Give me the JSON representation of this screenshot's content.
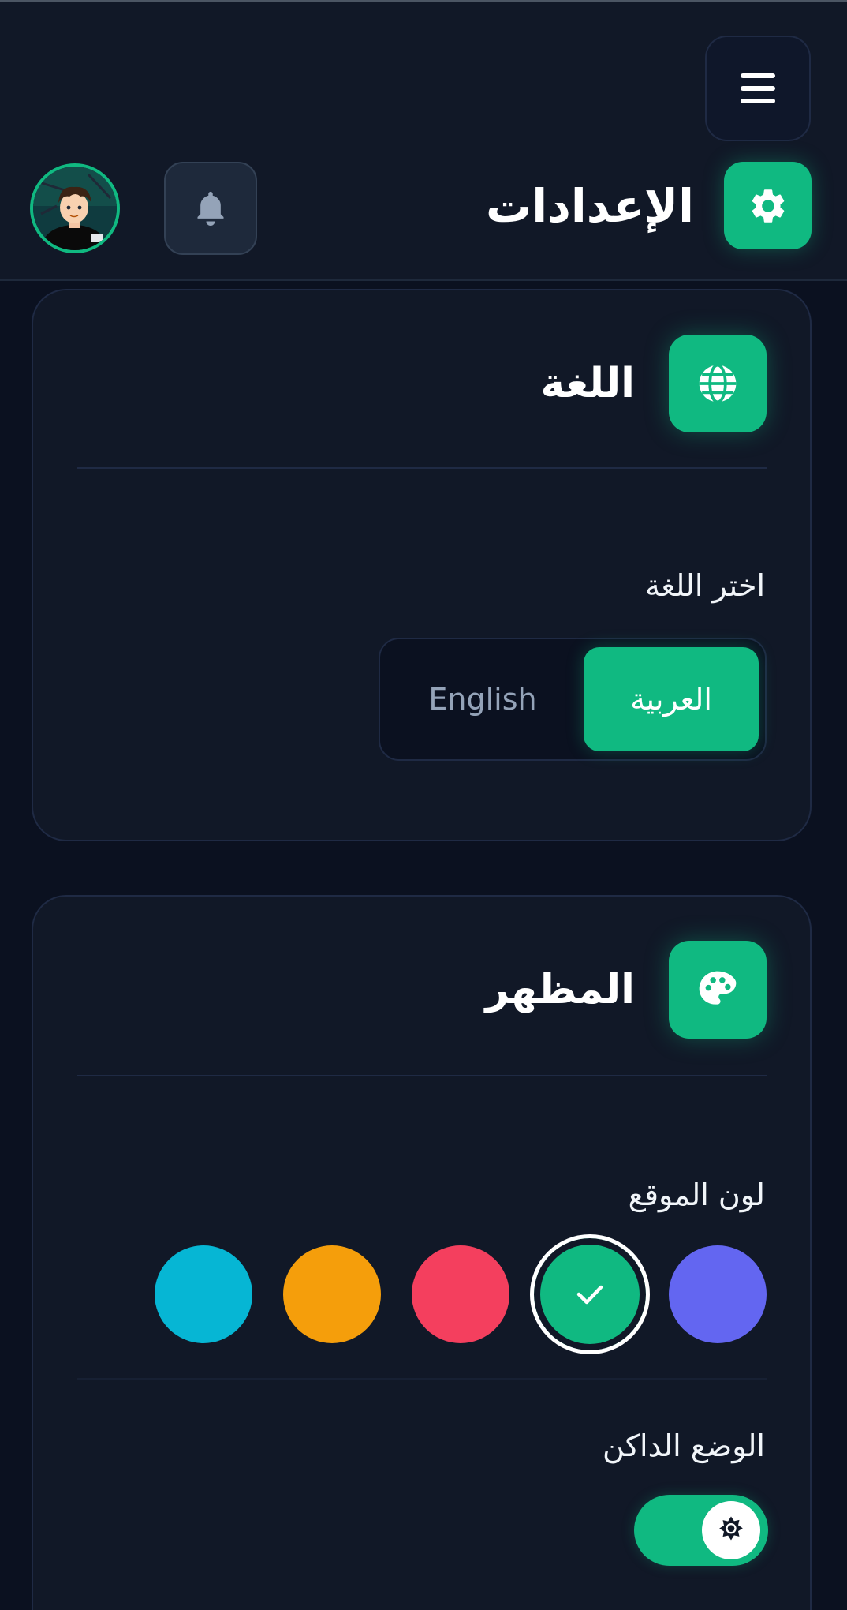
{
  "header": {
    "title": "الإعدادات",
    "menu_icon": "hamburger-icon",
    "settings_icon": "gear-icon",
    "notification_icon": "bell-icon",
    "avatar_desc": "user-avatar"
  },
  "language_card": {
    "title": "اللغة",
    "icon": "globe-icon",
    "label": "اختر اللغة",
    "options": [
      {
        "label": "العربية",
        "selected": true
      },
      {
        "label": "English",
        "selected": false
      }
    ]
  },
  "appearance_card": {
    "title": "المظهر",
    "icon": "palette-icon",
    "color_label": "لون الموقع",
    "colors": [
      {
        "name": "indigo",
        "hex": "#6366f1",
        "selected": false
      },
      {
        "name": "emerald",
        "hex": "#10b981",
        "selected": true
      },
      {
        "name": "rose",
        "hex": "#f43f5e",
        "selected": false
      },
      {
        "name": "amber",
        "hex": "#f59e0b",
        "selected": false
      },
      {
        "name": "cyan",
        "hex": "#06b6d4",
        "selected": false
      }
    ],
    "dark_mode_label": "الوضع الداكن",
    "dark_mode_on": true
  },
  "theme": {
    "accent": "#10b981",
    "background": "#0b1120",
    "card": "#111827"
  }
}
